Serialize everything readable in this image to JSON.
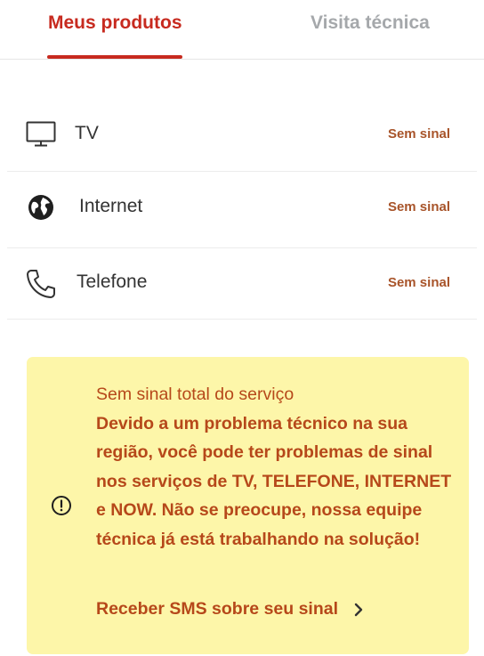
{
  "tabs": {
    "products_label": "Meus produtos",
    "visit_label": "Visita técnica",
    "active": "products"
  },
  "products": [
    {
      "name": "TV",
      "status": "Sem sinal",
      "icon": "tv-icon"
    },
    {
      "name": "Internet",
      "status": "Sem sinal",
      "icon": "globe-icon"
    },
    {
      "name": "Telefone",
      "status": "Sem sinal",
      "icon": "phone-icon"
    }
  ],
  "alert": {
    "icon": "exclamation-circle-icon",
    "title": "Sem sinal total do serviço",
    "body": "Devido a um problema técnico na sua região, você pode ter problemas de sinal nos serviços de TV, TELEFONE, INTERNET e NOW. Não se preocupe, nossa equipe técnica já está trabalhando na solução!",
    "link_label": "Receber SMS sobre seu sinal",
    "link_icon": "chevron-right-icon"
  },
  "colors": {
    "accent": "#c72a1f",
    "inactive_tab": "#a5a8ab",
    "status": "#a8542a",
    "alert_bg": "#fdf6a9",
    "alert_text": "#b6481a"
  }
}
